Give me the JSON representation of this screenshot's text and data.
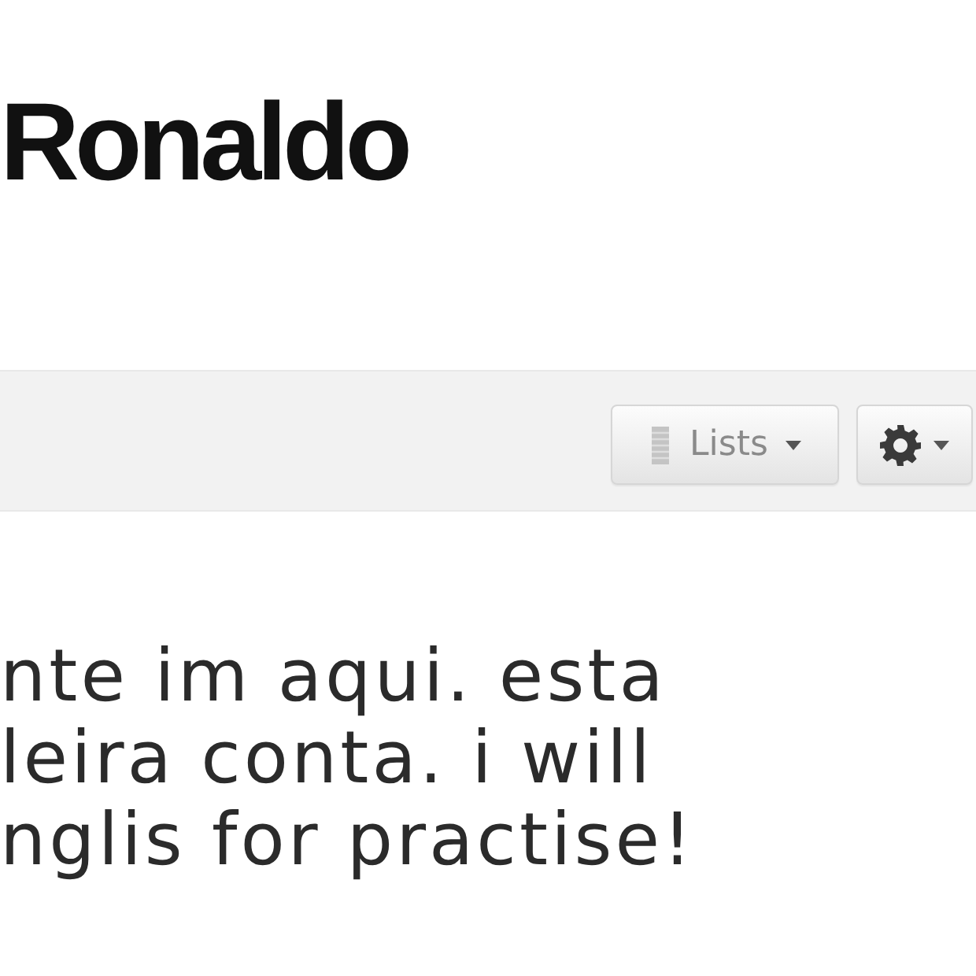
{
  "profile": {
    "name": "Ronaldo"
  },
  "toolbar": {
    "buttons": [
      {
        "kind": "lists",
        "label": "Lists"
      },
      {
        "kind": "settings"
      }
    ]
  },
  "tweet": {
    "lines": [
      "nte im aqui. esta",
      "leira conta. i will",
      "nglis for practise!"
    ]
  }
}
